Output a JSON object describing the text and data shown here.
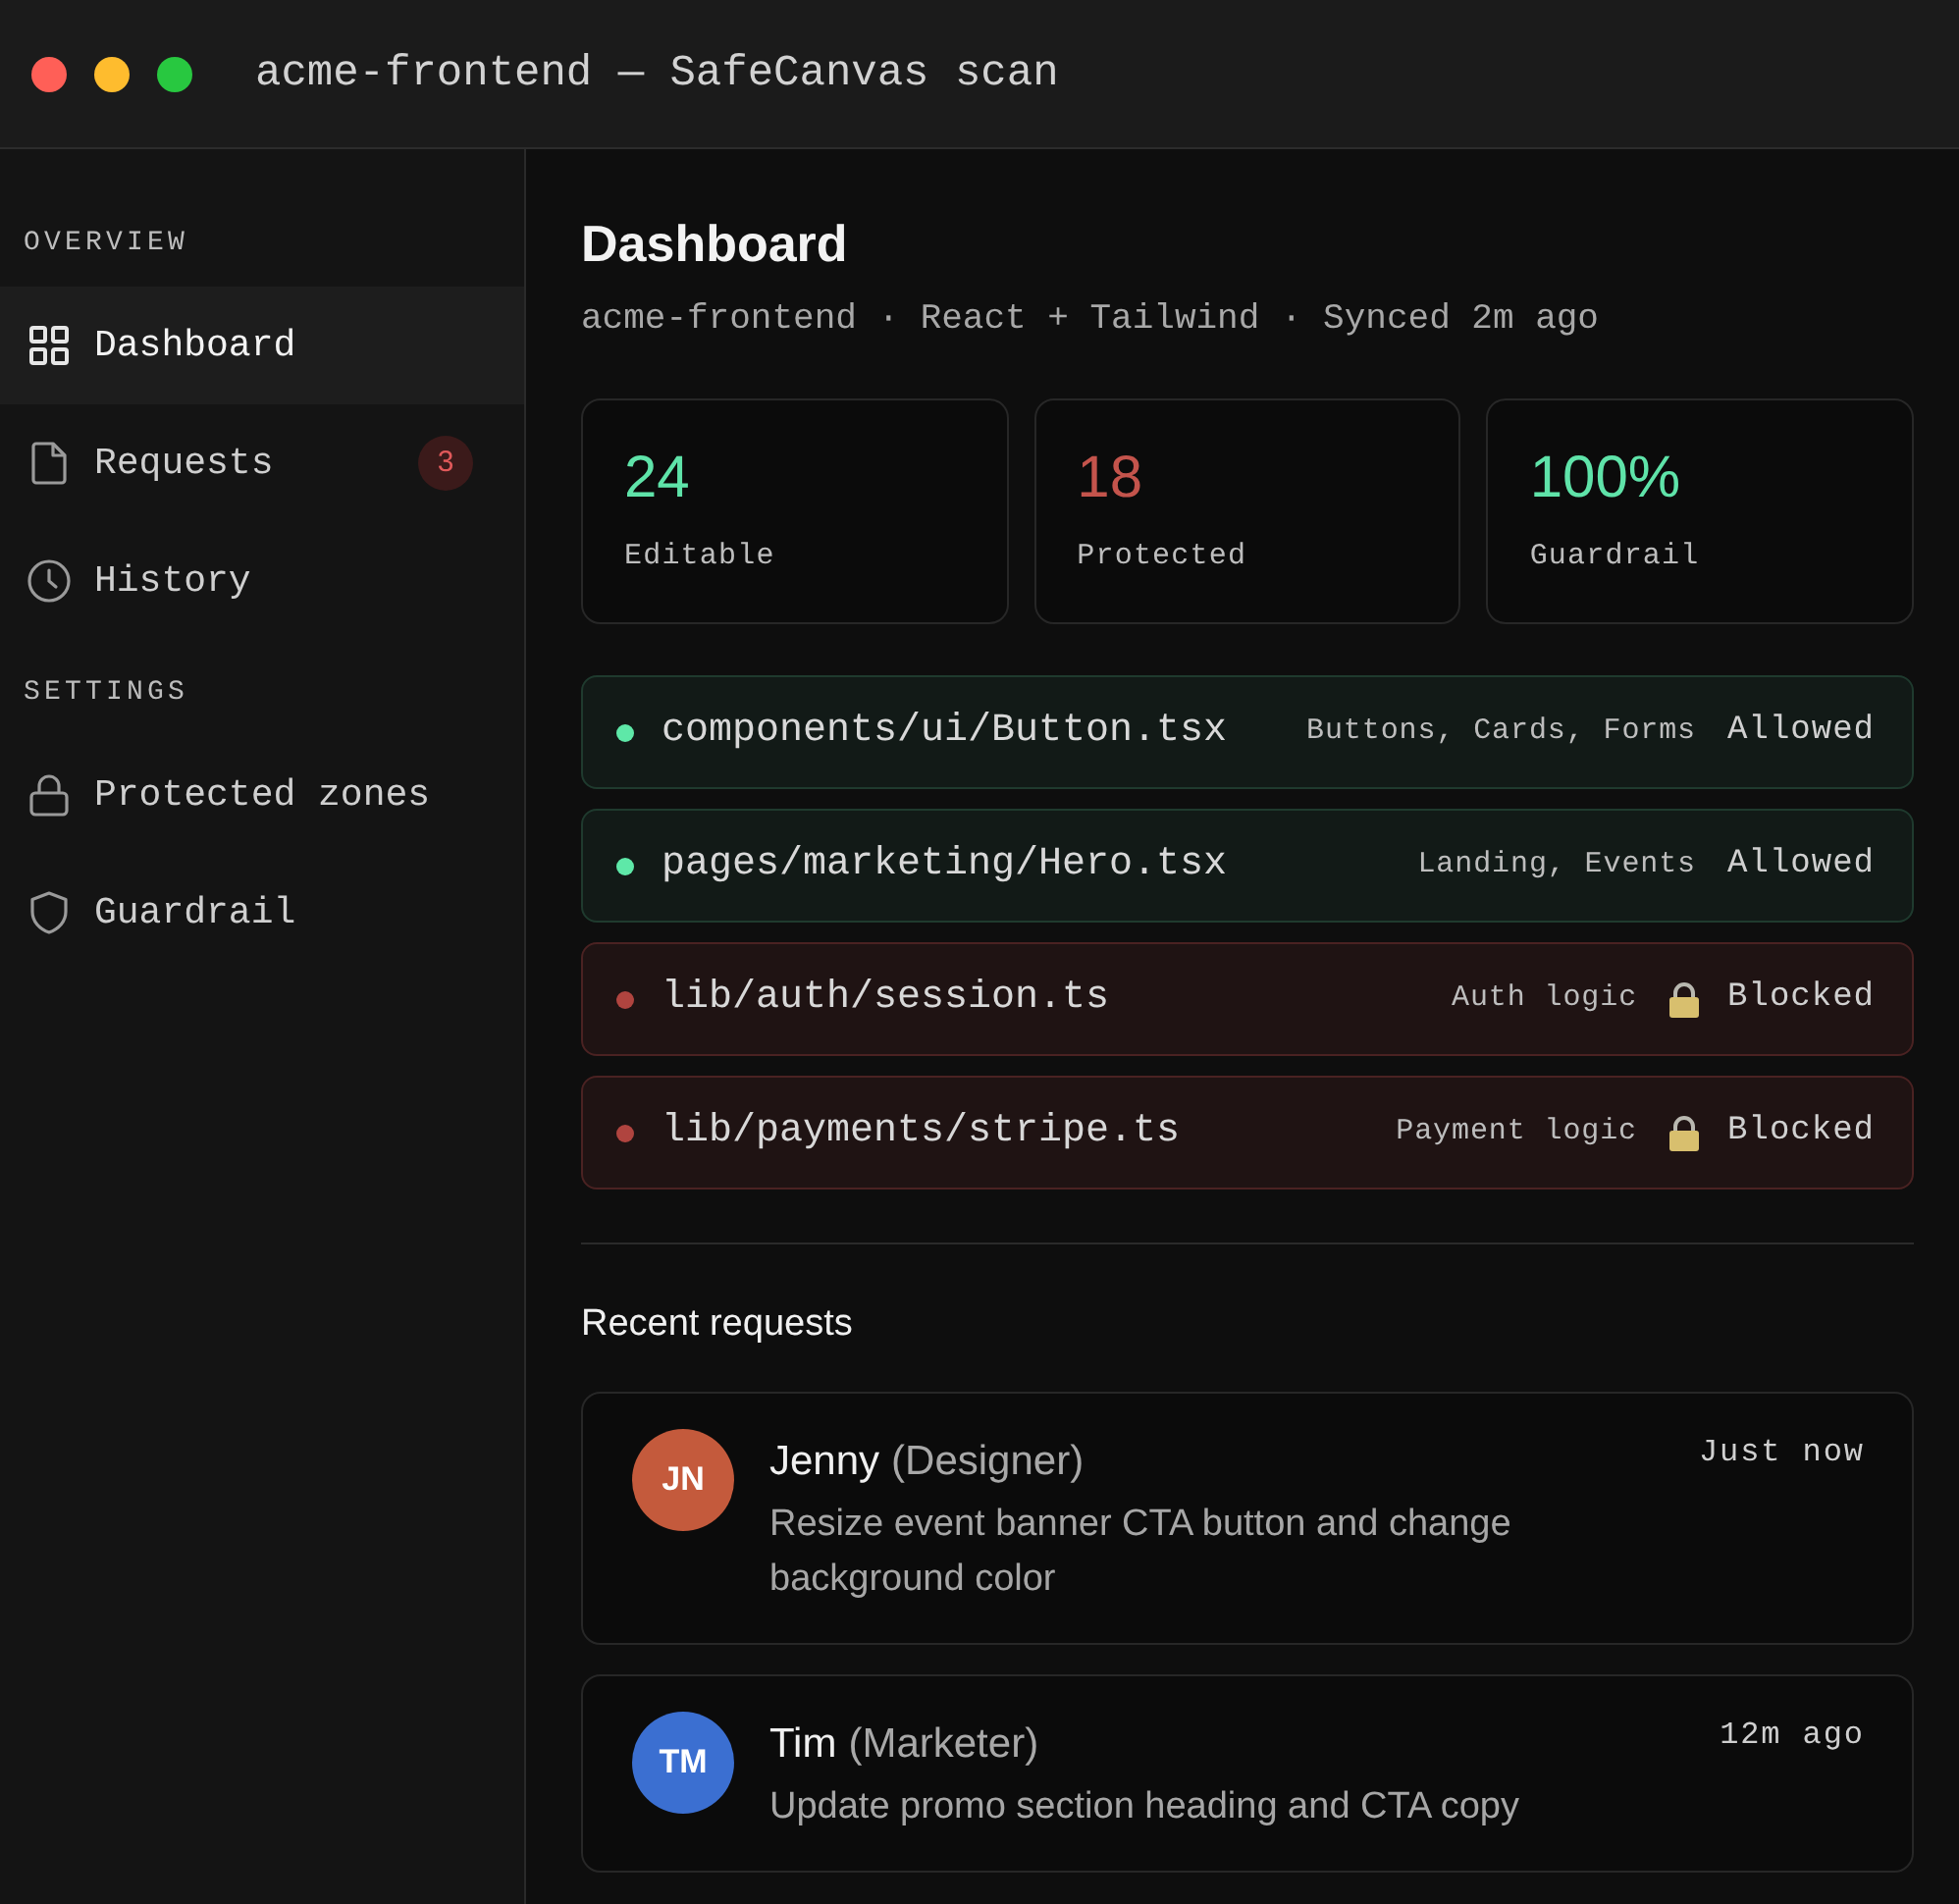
{
  "window": {
    "title": "acme-frontend — SafeCanvas scan"
  },
  "sidebar": {
    "sections": [
      {
        "heading": "OVERVIEW",
        "items": [
          {
            "label": "Dashboard",
            "selected": true
          },
          {
            "label": "Requests",
            "selected": false,
            "badge": "3"
          },
          {
            "label": "History",
            "selected": false
          }
        ]
      },
      {
        "heading": "SETTINGS",
        "items": [
          {
            "label": "Protected zones",
            "selected": false
          },
          {
            "label": "Guardrail",
            "selected": false
          }
        ]
      }
    ]
  },
  "header": {
    "title": "Dashboard",
    "subtitle": "acme-frontend · React + Tailwind · Synced 2m ago"
  },
  "stats": [
    {
      "value": "24",
      "label": "Editable",
      "color": "#5fe3a9"
    },
    {
      "value": "18",
      "label": "Protected",
      "color": "#c4544c"
    },
    {
      "value": "100%",
      "label": "Guardrail",
      "color": "#5fe3a9"
    }
  ],
  "files": [
    {
      "kind": "allowed",
      "path": "components/ui/Button.tsx",
      "tags": "Buttons, Cards, Forms",
      "status": "Allowed"
    },
    {
      "kind": "allowed",
      "path": "pages/marketing/Hero.tsx",
      "tags": "Landing, Events",
      "status": "Allowed"
    },
    {
      "kind": "blocked",
      "path": "lib/auth/session.ts",
      "tags": "Auth logic",
      "status": "Blocked"
    },
    {
      "kind": "blocked",
      "path": "lib/payments/stripe.ts",
      "tags": "Payment logic",
      "status": "Blocked"
    }
  ],
  "recent_requests": {
    "title": "Recent requests",
    "items": [
      {
        "initials": "JN",
        "color": "#c45a3c",
        "name": "Jenny",
        "role": "(Designer)",
        "time": "Just now",
        "message": "Resize event banner CTA button and change background color"
      },
      {
        "initials": "TM",
        "color": "#3b6fd1",
        "name": "Tim",
        "role": "(Marketer)",
        "time": "12m ago",
        "message": "Update promo section heading and CTA copy"
      }
    ]
  }
}
